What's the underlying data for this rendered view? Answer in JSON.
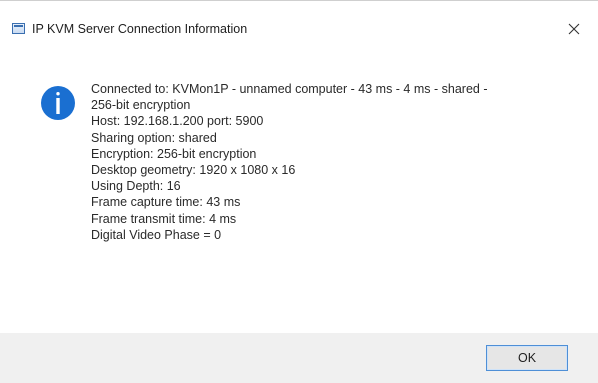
{
  "window": {
    "title": "IP KVM Server Connection Information",
    "close_icon": "close-icon",
    "app_icon": "window-app-icon"
  },
  "message": {
    "icon": "info-icon",
    "lines": [
      "Connected to: KVMon1P - unnamed computer - 43 ms - 4 ms - shared -",
      "256-bit encryption",
      "Host: 192.168.1.200 port: 5900",
      "Sharing option: shared",
      "Encryption: 256-bit encryption",
      "Desktop geometry: 1920 x 1080 x 16",
      "Using Depth: 16",
      "Frame capture time: 43 ms",
      "Frame transmit time: 4 ms",
      "Digital Video Phase = 0"
    ]
  },
  "footer": {
    "ok_label": "OK"
  },
  "colors": {
    "info_icon": "#1a6fd1",
    "footer_bg": "#f0f0f0",
    "button_focus_border": "#4f8fd6"
  }
}
